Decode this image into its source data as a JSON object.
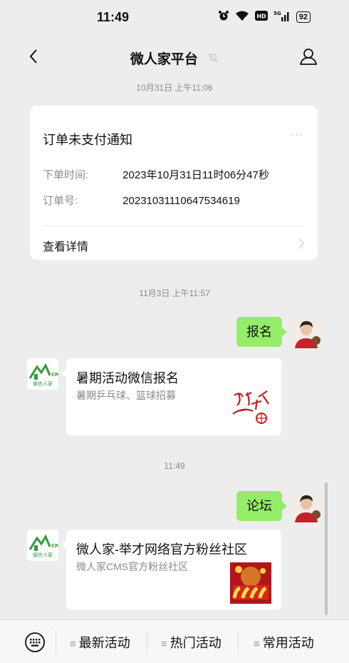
{
  "status_bar": {
    "time": "11:49",
    "signal": "5G",
    "battery": "92"
  },
  "nav": {
    "title": "微人家平台"
  },
  "messages": {
    "ts1": "10月31日 上午11:06",
    "order_card": {
      "title": "订单未支付通知",
      "more": "···",
      "rows": [
        {
          "key": "下单时间:",
          "value": "2023年10月31日11时06分47秒"
        },
        {
          "key": "订单号:",
          "value": "20231031110647534619"
        }
      ],
      "detail_label": "查看详情"
    },
    "ts2": "11月3日 上午11:57",
    "user_msg_1": "报名",
    "link1": {
      "title": "暑期活动微信报名",
      "desc": "暑期乒乓球、篮球招募"
    },
    "ts3": "11:49",
    "user_msg_2": "论坛",
    "link2": {
      "title": "微人家-举才网络官方粉丝社区",
      "desc": "微人家CMS官方粉丝社区"
    },
    "bot_logo_text": "微信人家"
  },
  "bottom_menu": {
    "items": [
      {
        "label": "最新活动"
      },
      {
        "label": "热门活动"
      },
      {
        "label": "常用活动"
      }
    ]
  }
}
